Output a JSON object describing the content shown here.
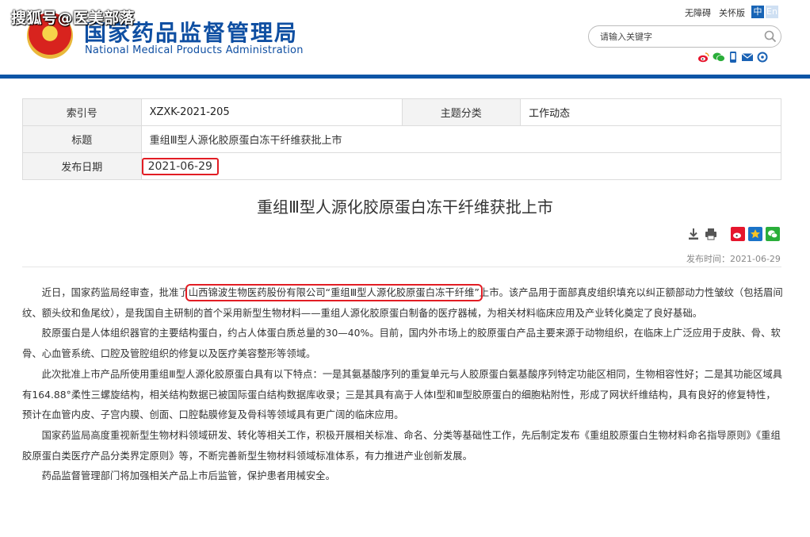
{
  "watermark": "搜狐号@医美部落",
  "site": {
    "title_cn": "国家药品监督管理局",
    "title_en": "National Medical Products Administration"
  },
  "top_links": {
    "accessible": "无障碍",
    "traditional": "关怀版",
    "lang_zh": "中",
    "lang_en": "En"
  },
  "search": {
    "placeholder": "请输入关键字"
  },
  "share_icons": [
    "weibo-icon",
    "wechat-icon",
    "mobile-icon",
    "mail-icon",
    "rss-icon"
  ],
  "meta": {
    "index_label": "索引号",
    "index_value": "XZXK-2021-205",
    "category_label": "主题分类",
    "category_value": "工作动态",
    "title_label": "标题",
    "title_value": "重组Ⅲ型人源化胶原蛋白冻干纤维获批上市",
    "date_label": "发布日期",
    "date_value": "2021-06-29"
  },
  "article": {
    "title": "重组Ⅲ型人源化胶原蛋白冻干纤维获批上市",
    "pub_time": "发布时间：2021-06-29",
    "p1_a": "近日，国家药监局经审查，批准了",
    "p1_hl": "山西锦波生物医药股份有限公司“重组Ⅲ型人源化胶原蛋白冻干纤维”",
    "p1_b": "上市。该产品用于面部真皮组织填充以纠正额部动力性皱纹（包括眉间纹、额头纹和鱼尾纹），是我国自主研制的首个采用新型生物材料——重组人源化胶原蛋白制备的医疗器械，为相关材料临床应用及产业转化奠定了良好基础。",
    "p2": "胶原蛋白是人体组织器官的主要结构蛋白，约占人体蛋白质总量的30—40%。目前，国内外市场上的胶原蛋白产品主要来源于动物组织，在临床上广泛应用于皮肤、骨、软骨、心血管系统、口腔及管腔组织的修复以及医疗美容整形等领域。",
    "p3": "此次批准上市产品所使用重组Ⅲ型人源化胶原蛋白具有以下特点：一是其氨基酸序列的重复单元与人胶原蛋白氨基酸序列特定功能区相同，生物相容性好；二是其功能区域具有164.88°柔性三螺旋结构，相关结构数据已被国际蛋白结构数据库收录；三是其具有高于人体Ⅰ型和Ⅲ型胶原蛋白的细胞粘附性，形成了网状纤维结构，具有良好的修复特性，预计在血管内皮、子宫内膜、创面、口腔黏膜修复及骨科等领域具有更广阔的临床应用。",
    "p4": "国家药监局高度重视新型生物材料领域研发、转化等相关工作，积极开展相关标准、命名、分类等基础性工作，先后制定发布《重组胶原蛋白生物材料命名指导原则》《重组胶原蛋白类医疗产品分类界定原则》等，不断完善新型生物材料领域标准体系，有力推进产业创新发展。",
    "p5": "药品监督管理部门将加强相关产品上市后监管，保护患者用械安全。"
  },
  "colors": {
    "brand_blue": "#0f4fa2",
    "header_bar": "#0d55a6",
    "highlight_red": "#e21d24"
  }
}
